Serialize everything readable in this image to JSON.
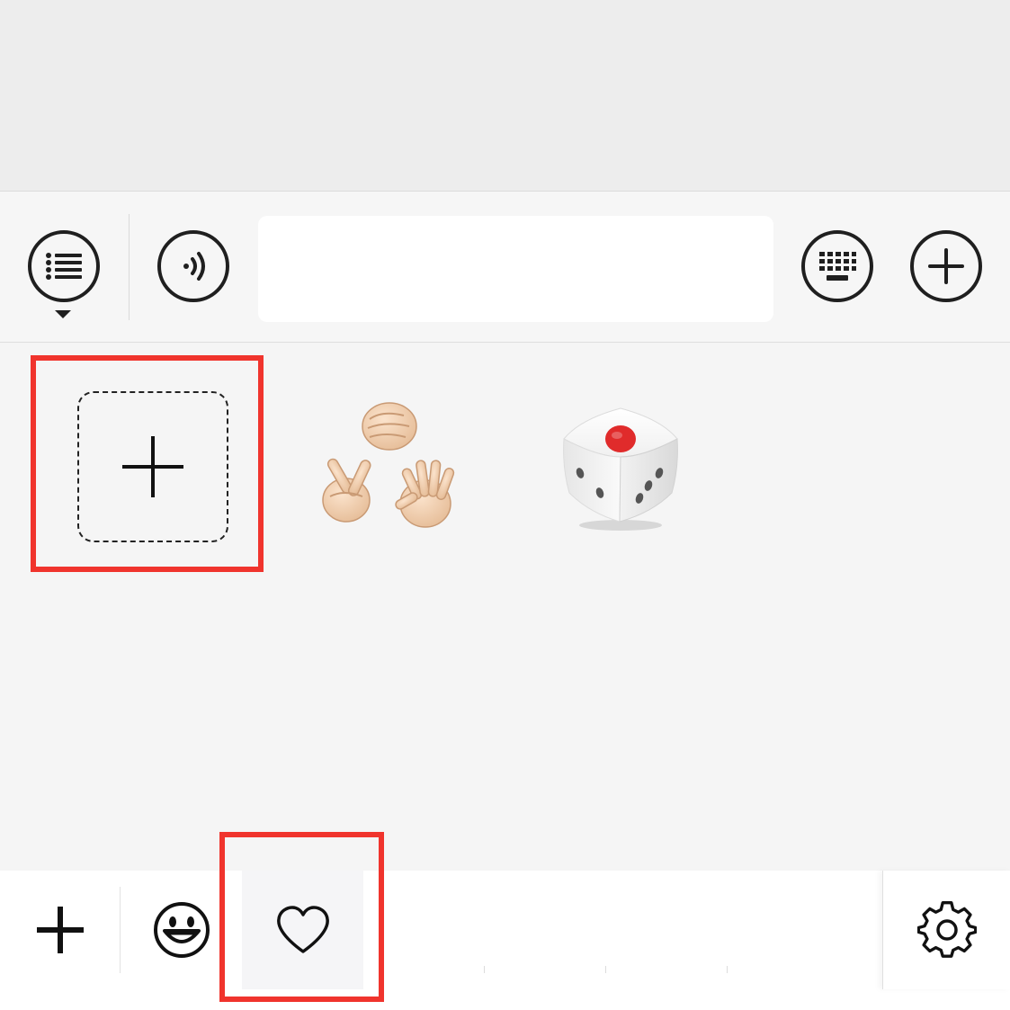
{
  "input_bar": {
    "text_value": "",
    "placeholder": ""
  },
  "sticker_panel": {
    "items": [
      {
        "name": "add-sticker",
        "icon": "plus-icon"
      },
      {
        "name": "rock-paper-scissors",
        "icon": "rock-paper-scissors-icon"
      },
      {
        "name": "dice",
        "icon": "dice-icon"
      }
    ]
  },
  "tabs": [
    {
      "name": "add",
      "icon": "plus-icon"
    },
    {
      "name": "emoji",
      "icon": "smiley-icon"
    },
    {
      "name": "favorites",
      "icon": "heart-icon",
      "selected": true
    },
    {
      "name": "settings",
      "icon": "gear-icon"
    }
  ],
  "colors": {
    "highlight": "#f0342d",
    "chat_background": "#ededed",
    "panel_background": "#f5f5f5",
    "icon_stroke": "#1f1f1f",
    "dice_pip_red": "#e02b2b"
  }
}
